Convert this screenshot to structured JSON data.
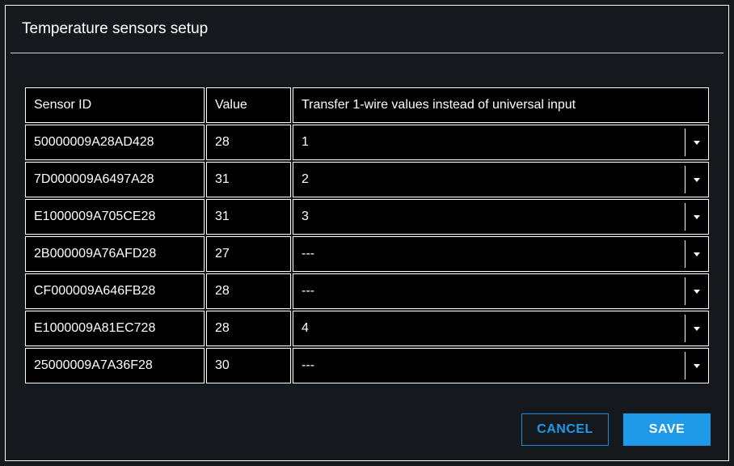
{
  "dialog": {
    "title": "Temperature sensors setup"
  },
  "table": {
    "headers": {
      "sensor_id": "Sensor ID",
      "value": "Value",
      "transfer": "Transfer 1-wire values instead of universal input"
    },
    "rows": [
      {
        "id": "50000009A28AD428",
        "value": "28",
        "transfer": "1"
      },
      {
        "id": "7D000009A6497A28",
        "value": "31",
        "transfer": "2"
      },
      {
        "id": "E1000009A705CE28",
        "value": "31",
        "transfer": "3"
      },
      {
        "id": "2B000009A76AFD28",
        "value": "27",
        "transfer": "---"
      },
      {
        "id": "CF000009A646FB28",
        "value": "28",
        "transfer": "---"
      },
      {
        "id": "E1000009A81EC728",
        "value": "28",
        "transfer": "4"
      },
      {
        "id": "25000009A7A36F28",
        "value": "30",
        "transfer": "---"
      }
    ]
  },
  "buttons": {
    "cancel": "CANCEL",
    "save": "SAVE"
  }
}
